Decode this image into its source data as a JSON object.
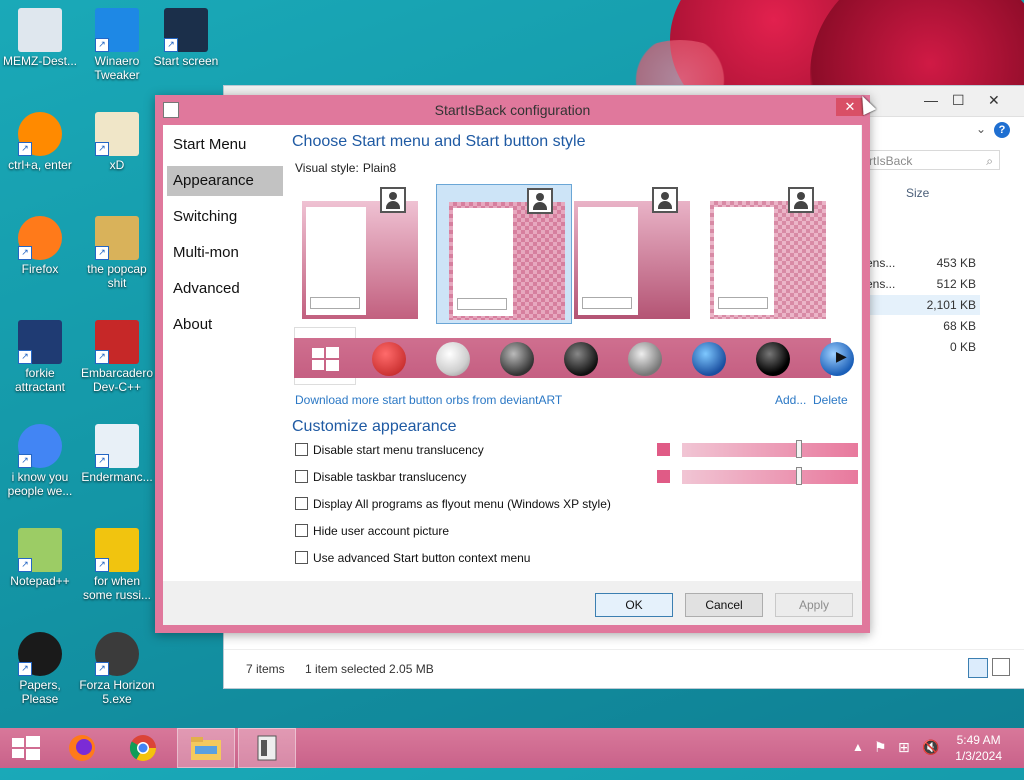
{
  "desktop": {
    "icons": [
      {
        "label": "MEMZ-Dest...",
        "icon": "recycle-bin-icon"
      },
      {
        "label": "Winaero Tweaker",
        "icon": "winaero-icon"
      },
      {
        "label": "Start screen",
        "icon": "start-screen-icon"
      },
      {
        "label": "ctrl+a, enter",
        "icon": "ring-icon"
      },
      {
        "label": "xD",
        "icon": "hxd-icon"
      },
      {
        "label": "Firefox",
        "icon": "firefox-icon"
      },
      {
        "label": "the popcap shit",
        "icon": "folder-icon"
      },
      {
        "label": "forkie attractant",
        "icon": "settings-monitor-icon"
      },
      {
        "label": "Embarcadero Dev-C++",
        "icon": "devcpp-icon"
      },
      {
        "label": "i know you people we...",
        "icon": "chrome-icon"
      },
      {
        "label": "Endermanc...",
        "icon": "window-icon"
      },
      {
        "label": "Notepad++",
        "icon": "notepadpp-icon"
      },
      {
        "label": "for when some russi...",
        "icon": "de-icon"
      },
      {
        "label": "Papers, Please",
        "icon": "papers-please-icon"
      },
      {
        "label": "Forza Horizon 5.exe",
        "icon": "flash-icon"
      }
    ]
  },
  "explorer": {
    "search_placeholder": "rtIsBack",
    "size_header": "Size",
    "files": [
      {
        "name": "ens...",
        "size": "453 KB",
        "selected": false
      },
      {
        "name": "ens...",
        "size": "512 KB",
        "selected": false
      },
      {
        "name": "",
        "size": "2,101 KB",
        "selected": true
      },
      {
        "name": "",
        "size": "68 KB",
        "selected": false
      },
      {
        "name": "",
        "size": "0 KB",
        "selected": false
      }
    ],
    "status_items": "7 items",
    "status_selected": "1 item selected  2.05 MB"
  },
  "dialog": {
    "title": "StartIsBack configuration",
    "close_label": "✕",
    "nav": [
      "Start Menu",
      "Appearance",
      "Switching",
      "Multi-mon",
      "Advanced",
      "About"
    ],
    "nav_selected": 1,
    "style_heading": "Choose Start menu and Start button style",
    "visual_style_label": "Visual style:",
    "visual_style_value": "Plain8",
    "download_link": "Download more start button orbs from deviantART",
    "add_link": "Add...",
    "delete_link": "Delete",
    "customize_heading": "Customize appearance",
    "checkboxes": [
      "Disable start menu translucency",
      "Disable taskbar translucency",
      "Display All programs as flyout menu (Windows XP style)",
      "Hide user account picture",
      "Use advanced Start button context menu"
    ],
    "sliders": [
      {
        "value": 0.67
      },
      {
        "value": 0.67
      }
    ],
    "ok_label": "OK",
    "cancel_label": "Cancel",
    "apply_label": "Apply"
  },
  "taskbar": {
    "clock_time": "5:49 AM",
    "clock_date": "1/3/2024"
  },
  "colors": {
    "accent_pink": "#e0789c",
    "heading_blue": "#1f5aa3",
    "link_blue": "#2b78c5"
  }
}
